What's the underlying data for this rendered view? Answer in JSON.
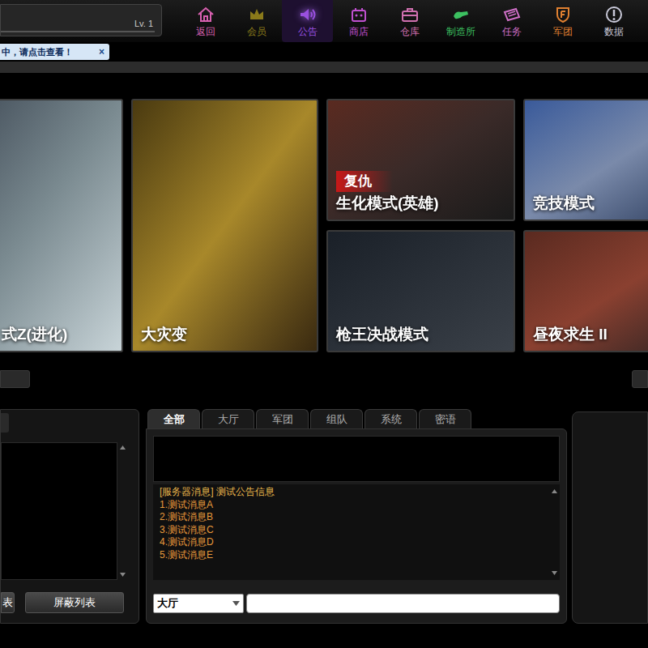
{
  "player": {
    "level": "Lv. 1"
  },
  "nav": [
    {
      "label": "返回",
      "selected": false,
      "color": "#d860b0"
    },
    {
      "label": "会员",
      "selected": false,
      "color": "#8a7a1a"
    },
    {
      "label": "公告",
      "selected": true,
      "color": "#9a50e0"
    },
    {
      "label": "商店",
      "selected": false,
      "color": "#c050d0"
    },
    {
      "label": "仓库",
      "selected": false,
      "color": "#d070b0"
    },
    {
      "label": "制造所",
      "selected": false,
      "color": "#3cc060"
    },
    {
      "label": "任务",
      "selected": false,
      "color": "#d070c8"
    },
    {
      "label": "军团",
      "selected": false,
      "color": "#e08030"
    },
    {
      "label": "数据",
      "selected": false,
      "color": "#c8c8d8"
    }
  ],
  "notice": {
    "text": "中，请点击查看！",
    "close": "×"
  },
  "modes": [
    {
      "title": "式Z(进化)"
    },
    {
      "title": "大灾变"
    },
    {
      "title": "生化模式(英雄)",
      "badge": "复仇"
    },
    {
      "title": "枪王决战模式"
    },
    {
      "title": "竞技模式"
    },
    {
      "title": "昼夜求生 II"
    }
  ],
  "friends": {
    "buttons": [
      "表",
      "屏蔽列表"
    ]
  },
  "chat": {
    "tabs": [
      {
        "label": "全部",
        "selected": true
      },
      {
        "label": "大厅",
        "selected": false
      },
      {
        "label": "军团",
        "selected": false
      },
      {
        "label": "组队",
        "selected": false
      },
      {
        "label": "系统",
        "selected": false
      },
      {
        "label": "密语",
        "selected": false
      }
    ],
    "messages": [
      {
        "text": "[服务器消息] 测试公告信息",
        "color": "#e8b64c"
      },
      {
        "text": "1.测试消息A",
        "color": "#e89a3c"
      },
      {
        "text": "2.测试消息B",
        "color": "#e89a3c"
      },
      {
        "text": "3.测试消息C",
        "color": "#e89a3c"
      },
      {
        "text": "4.测试消息D",
        "color": "#e89a3c"
      },
      {
        "text": "5.测试消息E",
        "color": "#e89a3c"
      }
    ],
    "channel": "大厅",
    "input": ""
  }
}
